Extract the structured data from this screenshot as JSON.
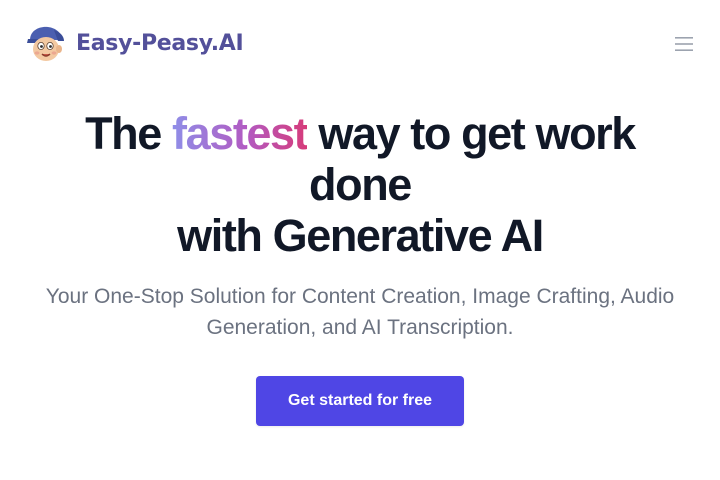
{
  "header": {
    "brand_name": "Easy-Peasy.AI",
    "logo_icon": "mascot-face-logo",
    "menu_icon": "hamburger-menu-icon"
  },
  "hero": {
    "headline_prefix": "The ",
    "headline_accent": "fastest",
    "headline_rest_1": " way to get work done",
    "headline_line_2": "with Generative AI",
    "subtitle": "Your One-Stop Solution for Content Creation, Image Crafting, Audio Generation, and AI Transcription.",
    "cta_label": "Get started for free"
  },
  "colors": {
    "brand_text": "#53509a",
    "headline_text": "#111827",
    "subtitle_text": "#6b7280",
    "cta_background": "#4f46e5",
    "accent_gradient_start": "#8f8ee8",
    "accent_gradient_end": "#d63b7a"
  }
}
